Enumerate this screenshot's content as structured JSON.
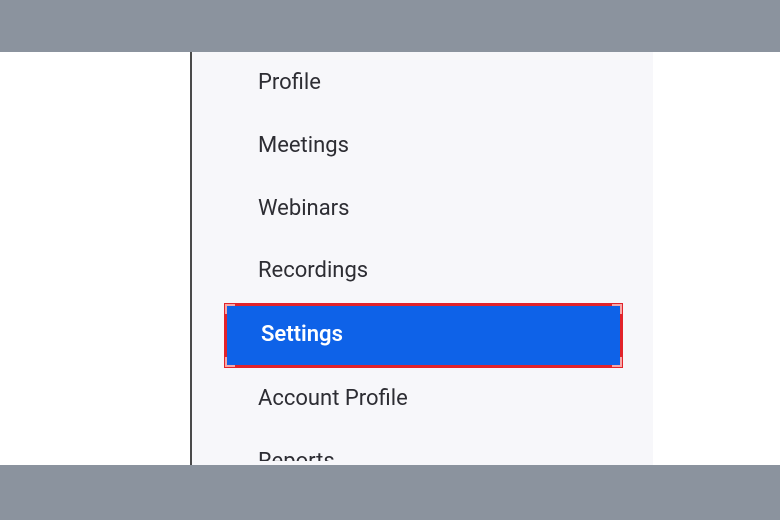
{
  "sidebar": {
    "items": [
      {
        "label": "Profile",
        "selected": false
      },
      {
        "label": "Meetings",
        "selected": false
      },
      {
        "label": "Webinars",
        "selected": false
      },
      {
        "label": "Recordings",
        "selected": false
      },
      {
        "label": "Settings",
        "selected": true
      },
      {
        "label": "Account Profile",
        "selected": false
      },
      {
        "label": "Reports",
        "selected": false
      }
    ]
  },
  "colors": {
    "selected_bg": "#0e62e8",
    "highlight_border": "#e2232a",
    "panel_bg": "#f7f7fa",
    "frame_bar": "#8b939e"
  }
}
